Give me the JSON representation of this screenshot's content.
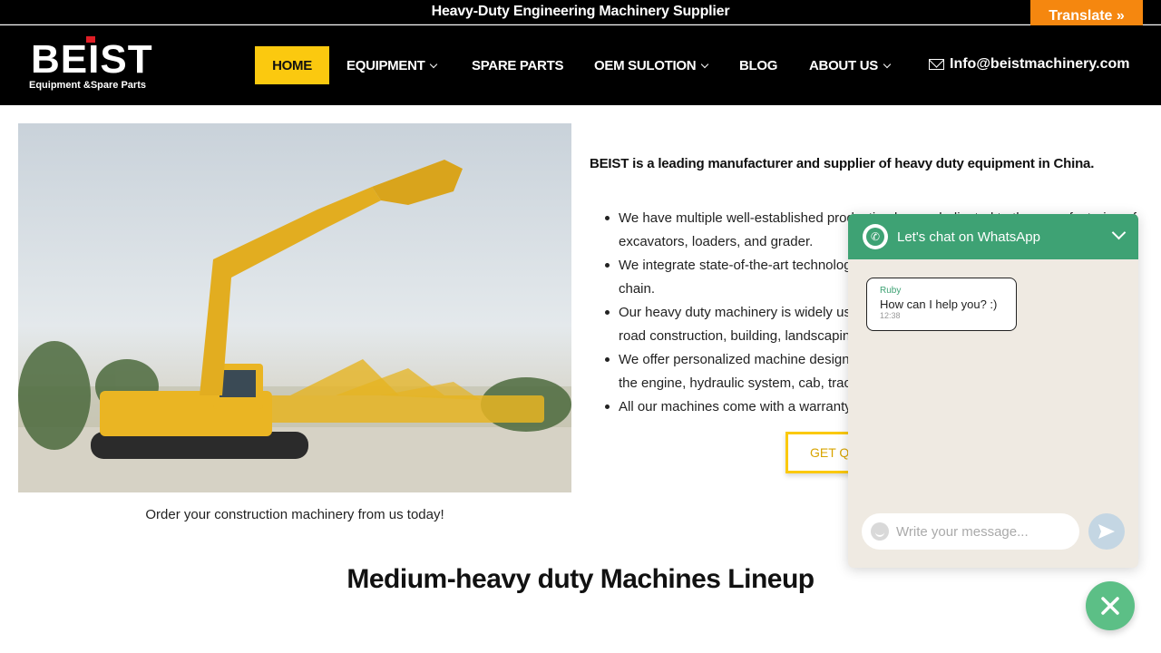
{
  "topbar": {
    "title": "Heavy-Duty Engineering Machinery Supplier",
    "translate_label": "Translate »"
  },
  "logo": {
    "word": "BEIST",
    "tagline": "Equipment &Spare Parts"
  },
  "nav": {
    "items": [
      {
        "label": "HOME",
        "active": true,
        "dropdown": false
      },
      {
        "label": "EQUIPMENT",
        "active": false,
        "dropdown": true
      },
      {
        "label": "SPARE PARTS",
        "active": false,
        "dropdown": false
      },
      {
        "label": "OEM SULOTION",
        "active": false,
        "dropdown": true
      },
      {
        "label": "BLOG",
        "active": false,
        "dropdown": false
      },
      {
        "label": "ABOUT US",
        "active": false,
        "dropdown": true
      }
    ],
    "email": "Info@beistmachinery.com"
  },
  "hero": {
    "caption": "Order your construction machinery from us today!",
    "intro": "BEIST is a leading manufacturer and supplier of heavy duty equipment in China.",
    "bullets": [
      "We have multiple well-established production bases dedicated to the manufacturing of",
      "excavators, loaders, and grader.",
      "We integrate state-of-the-art technology",
      "chain.",
      "Our heavy duty machinery is widely used",
      "road construction, building, landscaping",
      "We offer personalized machine design s",
      "the engine, hydraulic system, cab, tracks",
      "All our machines come with a warranty t"
    ],
    "quote_button": "GET QU"
  },
  "section_title": "Medium-heavy duty Machines Lineup",
  "whatsapp": {
    "header": "Let's chat on WhatsApp",
    "agent_name": "Ruby",
    "message": "How can I help you? :)",
    "time": "12:38",
    "input_placeholder": "Write your message...",
    "accent": "#3ea274",
    "fab_color": "#5cbf86"
  },
  "colors": {
    "brand_yellow": "#fbc90f",
    "translate_orange": "#f5870f"
  }
}
